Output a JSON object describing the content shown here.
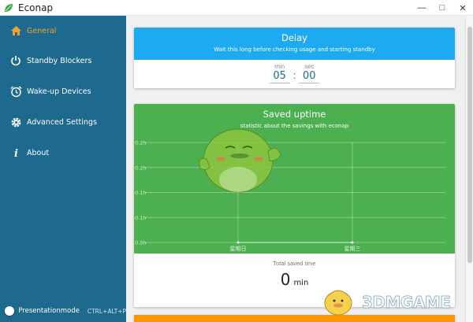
{
  "app": {
    "title": "Econap",
    "brand_color": "#1e6a8e",
    "accent": "#f2a12b"
  },
  "window_controls": {
    "minimize": "—",
    "maximize": "□",
    "close": "✕"
  },
  "sidebar": {
    "items": [
      {
        "label": "General",
        "icon": "home-icon",
        "active": true
      },
      {
        "label": "Standby Blockers",
        "icon": "power-icon"
      },
      {
        "label": "Wake-up Devices",
        "icon": "alarm-clock-icon"
      },
      {
        "label": "Advanced Settings",
        "icon": "gear-icon"
      },
      {
        "label": "About",
        "icon": "info-icon"
      }
    ],
    "presentation": {
      "label": "Presentationmode",
      "shortcut": "CTRL+ALT+P",
      "enabled": false
    }
  },
  "delay": {
    "title": "Delay",
    "subtitle": "Wait this long before checking usage and starting standby",
    "min_label": "min",
    "min_value": "05",
    "sec_label": "sec",
    "sec_value": "00",
    "header_color": "#1eaaf0"
  },
  "uptime": {
    "title": "Saved uptime",
    "subtitle": "statistic about the savings with econap",
    "total_label": "Total saved time",
    "total_value": "0",
    "total_unit": "min",
    "header_color": "#4caf50"
  },
  "chart_data": {
    "type": "line",
    "y_ticks": [
      "0.2h",
      "0.2h",
      "0.1h",
      "0.1h",
      "0.0h"
    ],
    "x_labels": [
      "星期日",
      "星期三"
    ],
    "series": [
      {
        "values": [
          0,
          0
        ]
      }
    ],
    "grid": true
  },
  "watermark": {
    "text": "3DMGAME"
  }
}
